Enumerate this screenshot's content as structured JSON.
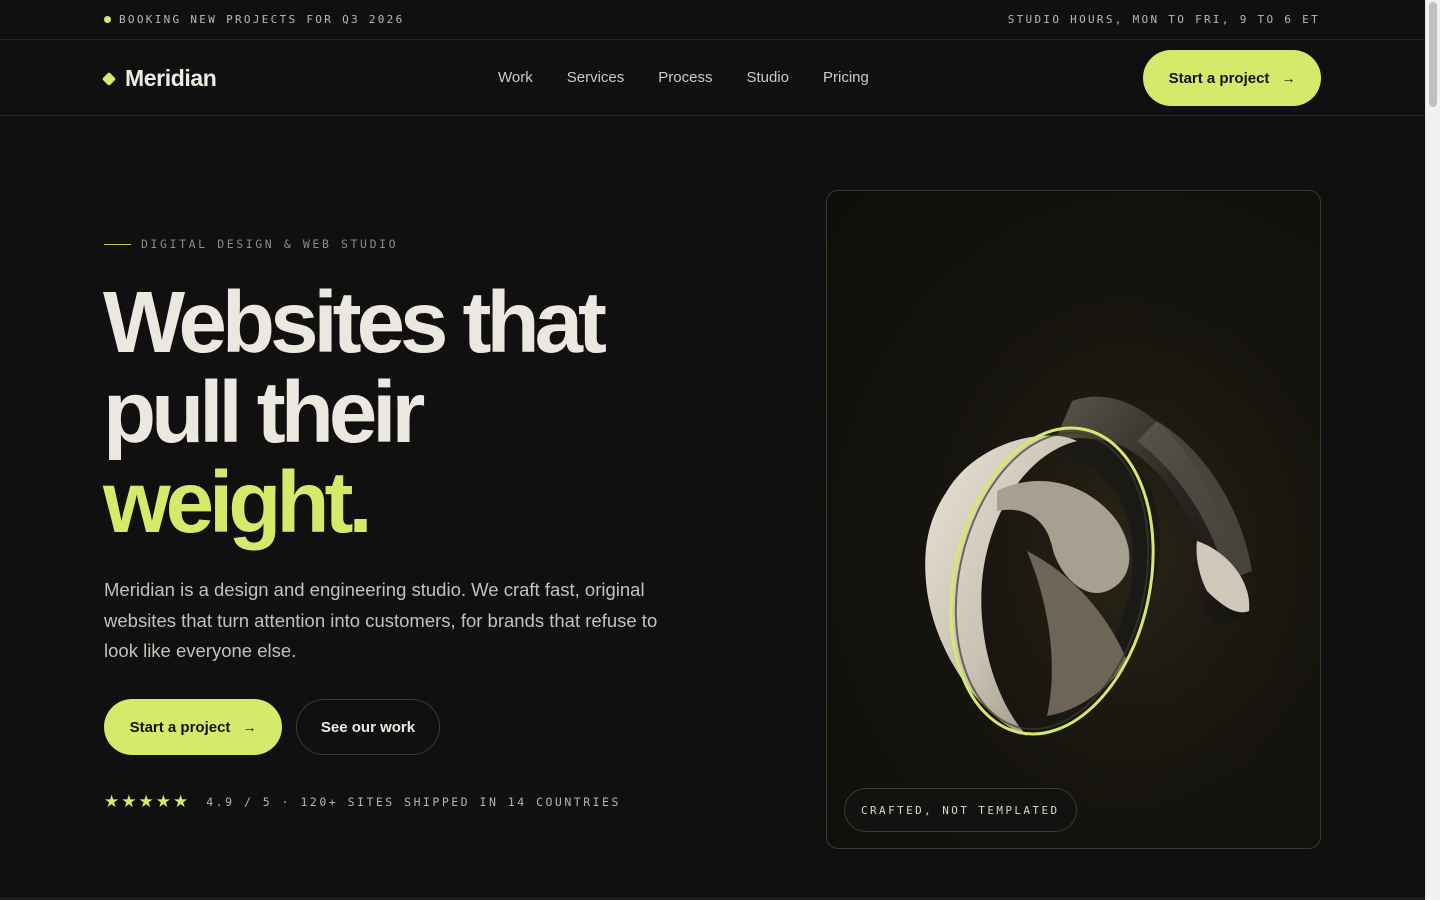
{
  "announcement": {
    "left_text": "BOOKING NEW PROJECTS FOR Q3 2026",
    "right_text": "STUDIO HOURS, MON TO FRI, 9 TO 6 ET"
  },
  "nav": {
    "logo_text": "Meridian",
    "links": [
      "Work",
      "Services",
      "Process",
      "Studio",
      "Pricing"
    ],
    "cta_label": "Start a project",
    "cta_icon": "arrow-right-icon"
  },
  "hero": {
    "eyebrow": "DIGITAL DESIGN & WEB STUDIO",
    "headline_line1": "Websites that",
    "headline_line2": "pull their",
    "headline_accent": "weight.",
    "lede": "Meridian is a design and engineering studio. We craft fast, original websites that turn attention into customers, for brands that refuse to look like everyone else.",
    "primary_cta": "Start a project",
    "secondary_cta": "See our work",
    "rating_stars": 5,
    "rating_text": "4.9 / 5 · 120+ SITES SHIPPED IN 14 COUNTRIES"
  },
  "visual": {
    "badge": "CRAFTED, NOT TEMPLATED"
  },
  "colors": {
    "accent": "#d4ea6b",
    "background": "#101010",
    "text": "#ece8e0"
  }
}
